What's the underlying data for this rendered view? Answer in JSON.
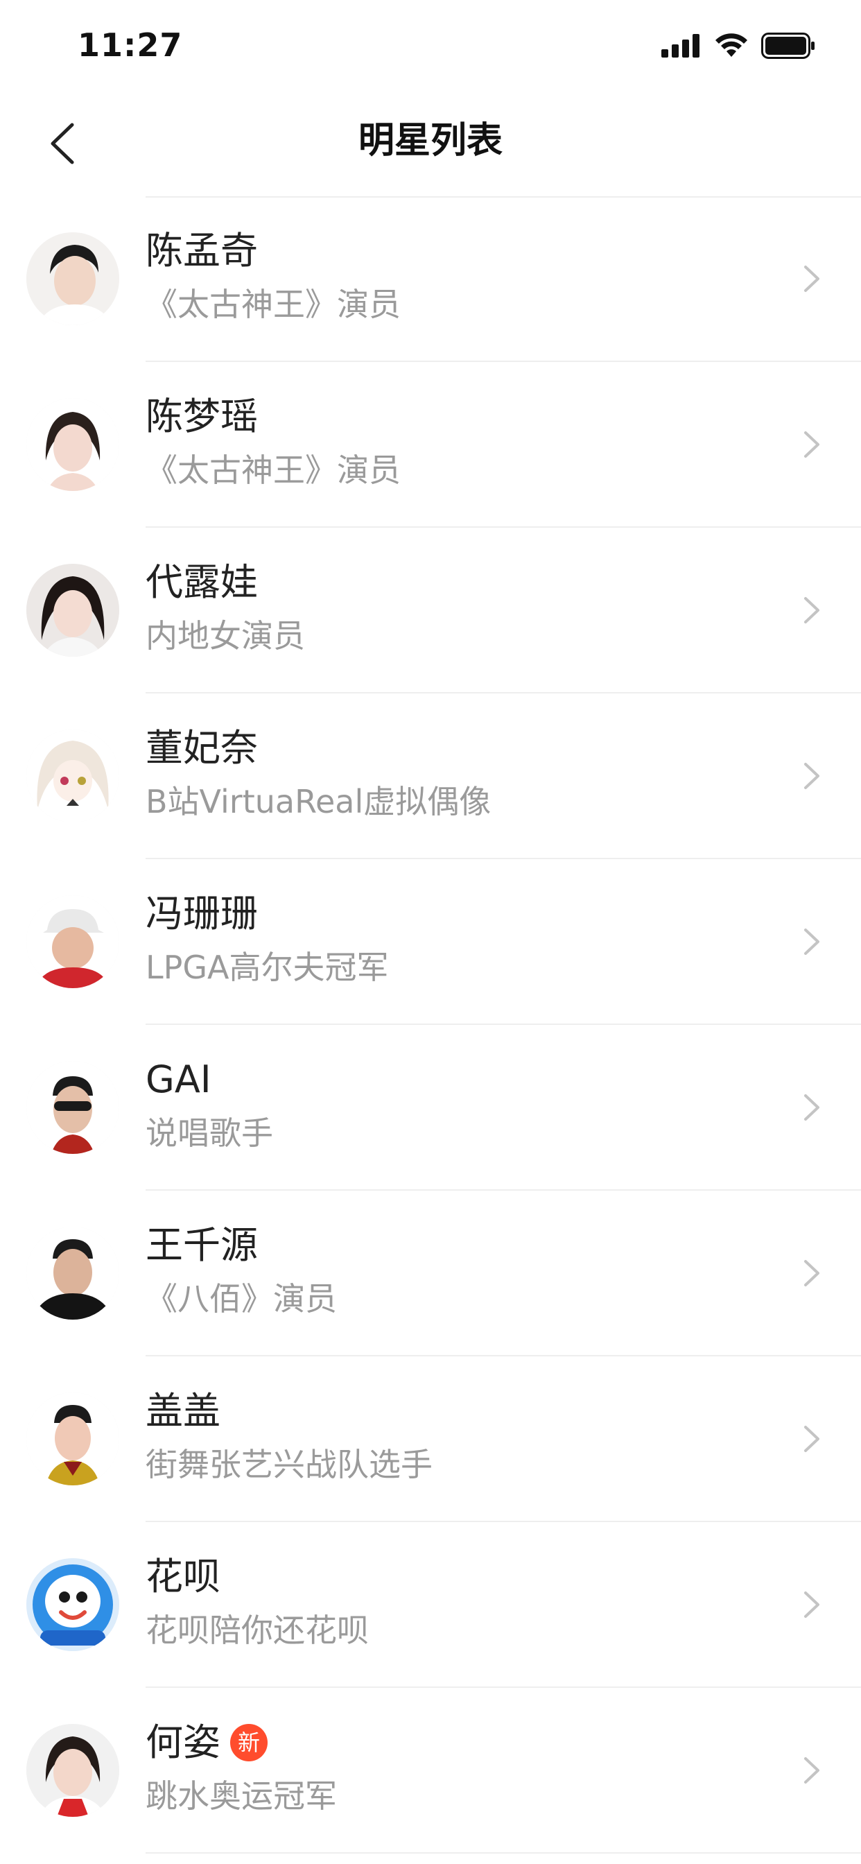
{
  "status_bar": {
    "time": "11:27"
  },
  "header": {
    "title": "明星列表"
  },
  "badge_color": "#ff4c2d",
  "items": [
    {
      "name": "陈孟奇",
      "subtitle": "《太古神王》演员",
      "badge": ""
    },
    {
      "name": "陈梦瑶",
      "subtitle": "《太古神王》演员",
      "badge": ""
    },
    {
      "name": "代露娃",
      "subtitle": "内地女演员",
      "badge": ""
    },
    {
      "name": "董妃奈",
      "subtitle": "B站VirtuaReal虚拟偶像",
      "badge": ""
    },
    {
      "name": "冯珊珊",
      "subtitle": "LPGA高尔夫冠军",
      "badge": ""
    },
    {
      "name": "GAI",
      "subtitle": "说唱歌手",
      "badge": ""
    },
    {
      "name": "王千源",
      "subtitle": "《八佰》演员",
      "badge": ""
    },
    {
      "name": "盖盖",
      "subtitle": "街舞张艺兴战队选手",
      "badge": ""
    },
    {
      "name": "花呗",
      "subtitle": "花呗陪你还花呗",
      "badge": ""
    },
    {
      "name": "何姿",
      "subtitle": "跳水奥运冠军",
      "badge": "新"
    }
  ]
}
